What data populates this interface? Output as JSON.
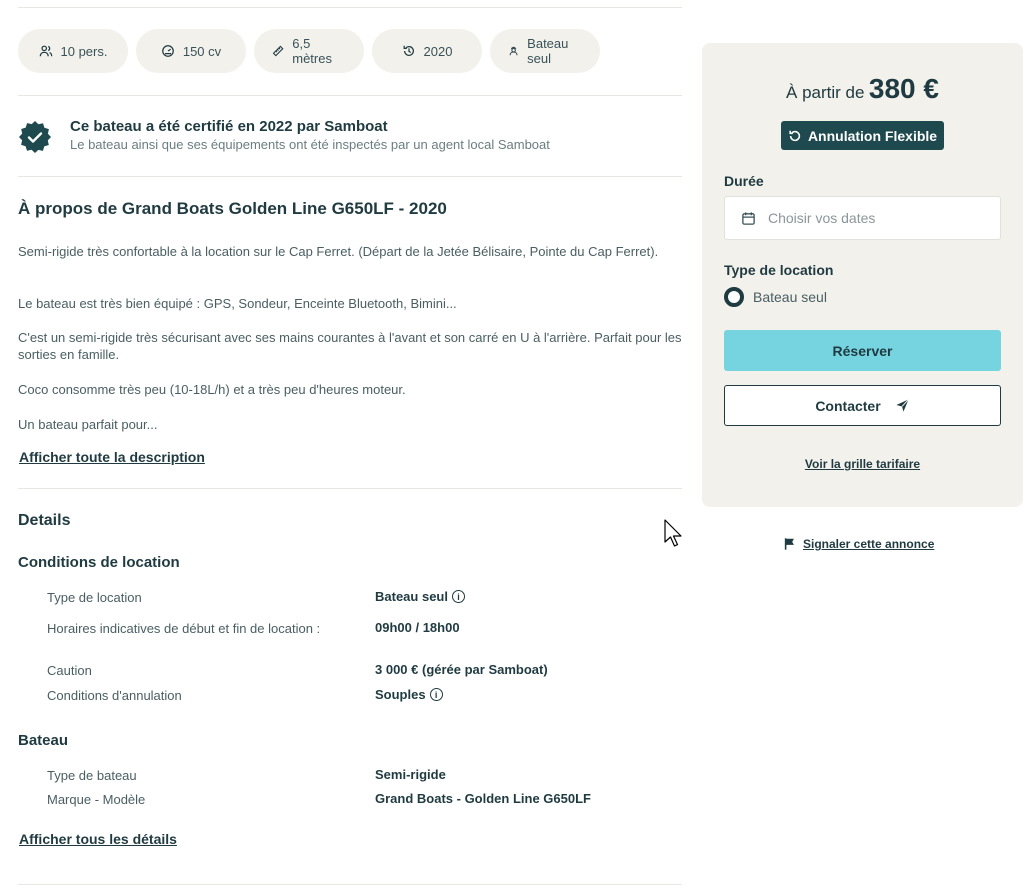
{
  "chips": [
    {
      "icon": "people-icon",
      "label": "10 pers."
    },
    {
      "icon": "engine-icon",
      "label": "150 cv"
    },
    {
      "icon": "ruler-icon",
      "label": "6,5 mètres"
    },
    {
      "icon": "history-icon",
      "label": "2020"
    },
    {
      "icon": "captain-icon",
      "label": "Bateau seul"
    }
  ],
  "certification": {
    "title": "Ce bateau a été certifié en 2022 par Samboat",
    "subtitle": "Le bateau ainsi que ses équipements ont été inspectés par un agent local Samboat"
  },
  "about": {
    "title": "À propos de Grand Boats Golden Line G650LF - 2020",
    "paragraphs": [
      "Semi-rigide très confortable à la location sur le Cap Ferret. (Départ de la Jetée Bélisaire, Pointe du Cap Ferret).",
      "Le bateau est très bien équipé : GPS, Sondeur, Enceinte Bluetooth, Bimini...",
      "C'est un semi-rigide très sécurisant avec ses mains courantes à l'avant et son carré en U à l'arrière. Parfait pour les sorties en famille.",
      "Coco consomme très peu (10-18L/h) et a très peu d'heures moteur.",
      "Un bateau parfait pour..."
    ],
    "show_more": "Afficher toute la description"
  },
  "details": {
    "title": "Details",
    "rental_conditions": {
      "title": "Conditions de location",
      "rows": [
        {
          "label": "Type de location",
          "value": "Bateau seul"
        },
        {
          "label": "Horaires indicatives de début et fin de location :",
          "value": "09h00 / 18h00"
        },
        {
          "label": "Caution",
          "value": "3 000 € (gérée par Samboat)"
        },
        {
          "label": "Conditions d'annulation",
          "value": "Souples"
        }
      ]
    },
    "boat": {
      "title": "Bateau",
      "rows": [
        {
          "label": "Type de bateau",
          "value": "Semi-rigide"
        },
        {
          "label": "Marque - Modèle",
          "value": "Grand Boats - Golden Line G650LF"
        }
      ]
    },
    "show_more": "Afficher tous les détails"
  },
  "booking": {
    "price_prefix": "À partir de",
    "price": "380 €",
    "cancellation_badge": "Annulation Flexible",
    "duration_label": "Durée",
    "date_placeholder": "Choisir vos dates",
    "rental_type_label": "Type de location",
    "rental_type_option": "Bateau seul",
    "reserve_button": "Réserver",
    "contact_button": "Contacter",
    "price_grid_link": "Voir la grille tarifaire"
  },
  "report_link": "Signaler cette annonce",
  "colors": {
    "primary_dark": "#1f3a40",
    "badge_bg": "#1e4a4f",
    "reserve_bg": "#76d4e0",
    "card_bg": "#f2f1ec"
  }
}
